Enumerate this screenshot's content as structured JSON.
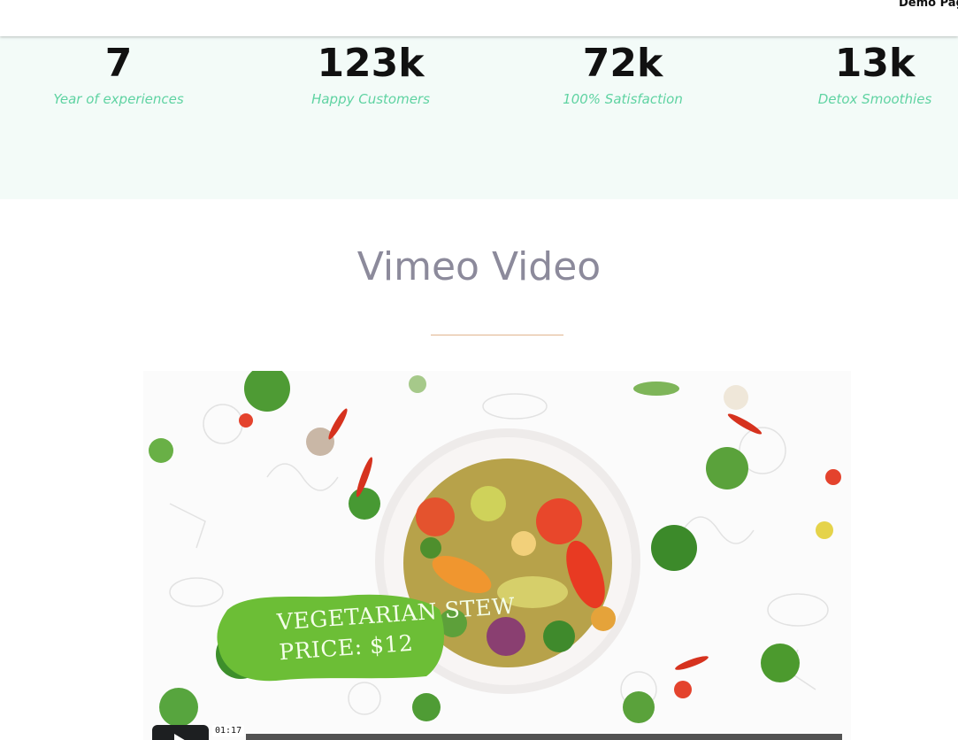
{
  "header": {
    "demo_label": "Demo Pag"
  },
  "stats": [
    {
      "value": "7",
      "label": "Year of experiences"
    },
    {
      "value": "123k",
      "label": "Happy Customers"
    },
    {
      "value": "72k",
      "label": "100% Satisfaction"
    },
    {
      "value": "13k",
      "label": "Detox Smoothies"
    }
  ],
  "section": {
    "title": "Vimeo Video"
  },
  "video": {
    "badge_line1": "VEGETARIAN STEW",
    "badge_line2": "PRICE: $12",
    "time": "01:17"
  },
  "colors": {
    "stats_bg": "#f3fbf8",
    "stats_label": "#5fd3a2",
    "title": "#8c8a9b",
    "divider": "#e1b48e"
  }
}
